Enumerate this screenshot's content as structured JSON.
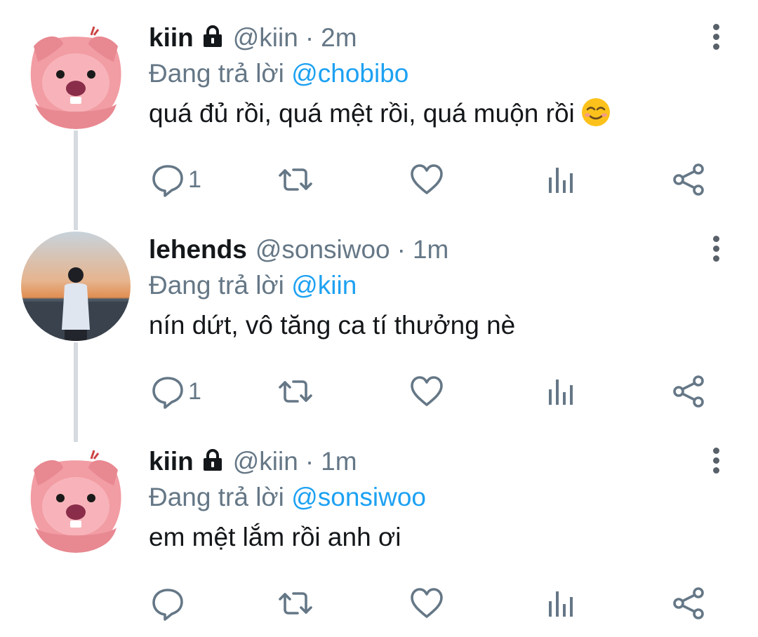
{
  "tweets": [
    {
      "name": "kiin",
      "handle": "@kiin",
      "separator": "·",
      "time": "2m",
      "replying_prefix": "Đang trả lời",
      "replying_to": "@chobibo",
      "text": "quá đủ rồi, quá mệt rồi, quá muộn rồi",
      "emoji": "smiling-face-with-smiling-eyes",
      "reply_count": "1",
      "locked": true,
      "avatar": "pink-beaver-avatar"
    },
    {
      "name": "lehends",
      "handle": "@sonsiwoo",
      "separator": "·",
      "time": "1m",
      "replying_prefix": "Đang trả lời",
      "replying_to": "@kiin",
      "text": "nín dứt, vô tăng ca tí thưởng nè",
      "reply_count": "1",
      "locked": false,
      "avatar": "sunset-photo-avatar"
    },
    {
      "name": "kiin",
      "handle": "@kiin",
      "separator": "·",
      "time": "1m",
      "replying_prefix": "Đang trả lời",
      "replying_to": "@sonsiwoo",
      "text": "em mệt lắm rồi anh ơi",
      "reply_count": "",
      "locked": true,
      "avatar": "pink-beaver-avatar"
    }
  ],
  "colors": {
    "link": "#1da1f2",
    "secondary": "#657786",
    "text": "#14171a",
    "thread_line": "#d6dbe0"
  }
}
